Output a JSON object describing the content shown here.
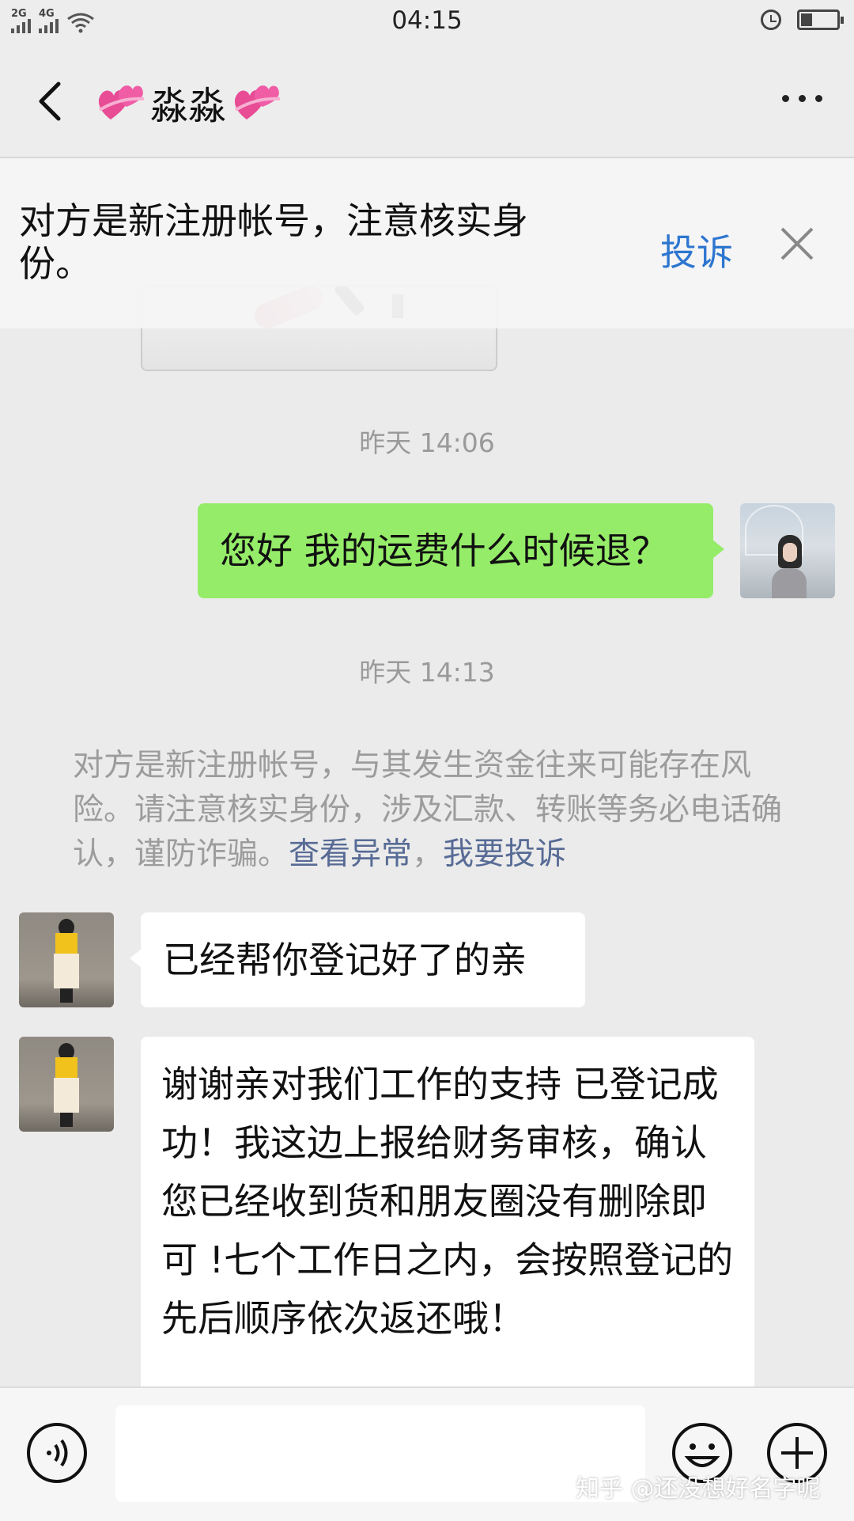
{
  "status_bar": {
    "sim1": "2G",
    "sim2": "4G",
    "time": "04:15"
  },
  "header": {
    "title": "淼淼"
  },
  "notice": {
    "text": "对方是新注册帐号，注意核实身份。",
    "report_label": "投诉"
  },
  "messages": {
    "ts1": "昨天 14:06",
    "sent1": "您好 我的运费什么时候退？",
    "ts2": "昨天 14:13",
    "system_text": "对方是新注册帐号，与其发生资金往来可能存在风险。请注意核实身份，涉及汇款、转账等务必电话确认，谨防诈骗。",
    "system_link1": "查看异常",
    "system_sep": "，",
    "system_link2": "我要投诉",
    "recv1": "已经帮你登记好了的亲",
    "recv2": "谢谢亲对我们工作的支持  已登记成功！我这边上报给财务审核，确认您已经收到货和朋友圈没有删除即可 !七个工作日之内，会按照登记的先后顺序依次返还哦！"
  },
  "watermark": "知乎 @还没想好名字呢",
  "colors": {
    "sent_bubble": "#95ec69",
    "link": "#576b95",
    "report": "#2d76d0"
  }
}
